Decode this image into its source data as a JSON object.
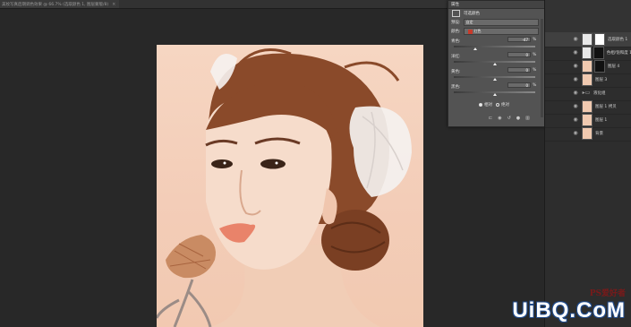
{
  "document": {
    "tab_label": "美妆写真后期调色效果 @ 66.7% (选取颜色 1, 图层蒙版/8)",
    "close": "×"
  },
  "properties": {
    "panel_title": "属性",
    "header": "可选颜色",
    "preset_label": "预设:",
    "preset_value": "自定",
    "colors_label": "颜色:",
    "colors_value": "红色",
    "sliders": [
      {
        "label": "青色:",
        "value": "-47",
        "unit": "%",
        "level": -0.47
      },
      {
        "label": "洋红:",
        "value": "0",
        "unit": "%",
        "level": 0
      },
      {
        "label": "黄色:",
        "value": "0",
        "unit": "%",
        "level": 0
      },
      {
        "label": "黑色:",
        "value": "0",
        "unit": "%",
        "level": 0
      }
    ],
    "mode_relative": "相对",
    "mode_absolute": "绝对"
  },
  "layers": [
    {
      "name": "选取颜色 1",
      "kind": "adjustment",
      "selected": true
    },
    {
      "name": "色相/饱和度 1",
      "kind": "adjustment-dark"
    },
    {
      "name": "图层 4",
      "kind": "pixel-mask"
    },
    {
      "name": "图层 3",
      "kind": "pixel"
    },
    {
      "name": "液化组",
      "kind": "folder"
    },
    {
      "name": "图层 1 拷贝",
      "kind": "pixel"
    },
    {
      "name": "图层 1",
      "kind": "pixel"
    },
    {
      "name": "背景",
      "kind": "pixel-locked"
    }
  ],
  "watermark": {
    "top": "PS爱好者",
    "bottom": "UiBQ.CoM"
  },
  "colors": {
    "accent_swatch": "#c83a2a",
    "panel_bg": "#535353",
    "canvas_bg": "#282828"
  }
}
